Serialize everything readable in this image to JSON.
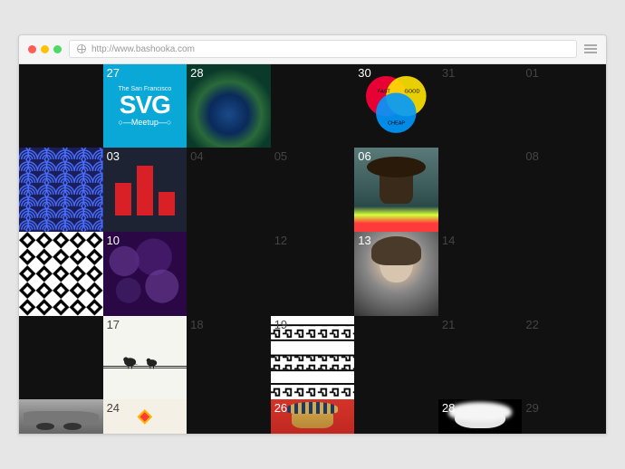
{
  "browser": {
    "url": "http://www.bashooka.com",
    "dots": [
      "#ff5d52",
      "#ffc107",
      "#4cd964"
    ]
  },
  "grid": {
    "rows": [
      [
        {
          "day": "",
          "thumb": null
        },
        {
          "day": "27",
          "bright": true,
          "thumb": "svgmeetup"
        },
        {
          "day": "28",
          "bright": true,
          "thumb": "peacock"
        },
        {
          "day": "",
          "thumb": null
        },
        {
          "day": "30",
          "bright": true,
          "thumb": "venn"
        },
        {
          "day": "31",
          "thumb": null
        },
        {
          "day": "01",
          "thumb": null
        }
      ],
      [
        {
          "day": "",
          "thumb": "wave"
        },
        {
          "day": "03",
          "bright": true,
          "thumb": "bars"
        },
        {
          "day": "04",
          "thumb": null
        },
        {
          "day": "05",
          "thumb": null
        },
        {
          "day": "06",
          "bright": true,
          "thumb": "muscle"
        },
        {
          "day": "",
          "thumb": null
        },
        {
          "day": "08",
          "thumb": null
        }
      ],
      [
        {
          "day": "",
          "thumb": "bw"
        },
        {
          "day": "10",
          "bright": true,
          "thumb": "bokeh"
        },
        {
          "day": "",
          "thumb": null
        },
        {
          "day": "12",
          "thumb": null
        },
        {
          "day": "13",
          "bright": true,
          "thumb": "portrait"
        },
        {
          "day": "14",
          "thumb": null
        },
        {
          "day": "",
          "thumb": null
        }
      ],
      [
        {
          "day": "",
          "thumb": null
        },
        {
          "day": "17",
          "bright": false,
          "thumb": "birds"
        },
        {
          "day": "18",
          "thumb": null
        },
        {
          "day": "19",
          "bright": false,
          "thumb": "greek"
        },
        {
          "day": "",
          "thumb": null
        },
        {
          "day": "21",
          "thumb": null
        },
        {
          "day": "22",
          "thumb": null
        }
      ],
      [
        {
          "day": "",
          "thumb": "car"
        },
        {
          "day": "24",
          "bright": false,
          "thumb": "dlogo"
        },
        {
          "day": "",
          "thumb": null
        },
        {
          "day": "26",
          "bright": true,
          "thumb": "egypt"
        },
        {
          "day": "",
          "thumb": null
        },
        {
          "day": "28",
          "bright": true,
          "thumb": "einstein"
        },
        {
          "day": "29",
          "thumb": null
        }
      ]
    ]
  },
  "thumbs": {
    "svgmeetup": {
      "sf": "The San Francisco",
      "big": "SVG",
      "mu": "Meetup"
    },
    "venn": {
      "labels": [
        "FAST",
        "GOOD",
        "CHEAP"
      ]
    }
  }
}
